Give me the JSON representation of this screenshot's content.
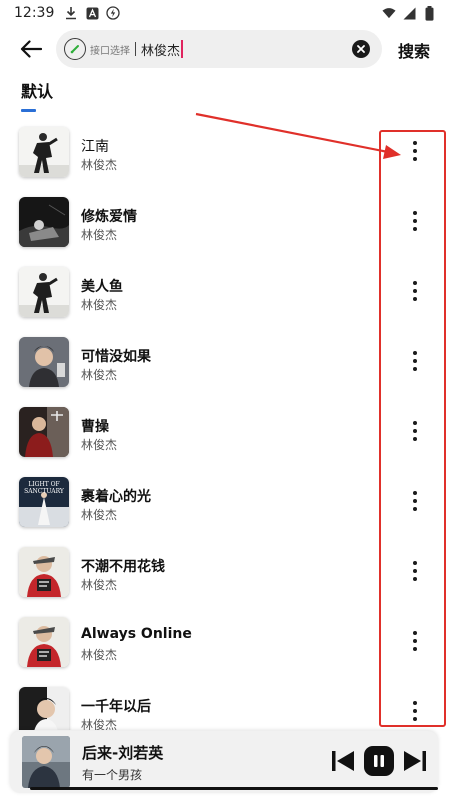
{
  "status_bar": {
    "time": "12:39",
    "left_icons": [
      "download-icon",
      "font-app-icon",
      "flash-icon"
    ],
    "right_icons": [
      "wifi-icon",
      "signal-icon",
      "battery-icon"
    ]
  },
  "search": {
    "api_label": "接口选择",
    "query": "林俊杰",
    "action_label": "搜索"
  },
  "tabs": [
    {
      "label": "默认",
      "active": true
    }
  ],
  "songs": [
    {
      "title": "江南",
      "artist": "林俊杰",
      "bold": false
    },
    {
      "title": "修炼爱情",
      "artist": "林俊杰",
      "bold": true
    },
    {
      "title": "美人鱼",
      "artist": "林俊杰",
      "bold": true
    },
    {
      "title": "可惜没如果",
      "artist": "林俊杰",
      "bold": true
    },
    {
      "title": "曹操",
      "artist": "林俊杰",
      "bold": true
    },
    {
      "title": "裹着心的光",
      "artist": "林俊杰",
      "bold": true
    },
    {
      "title": "不潮不用花钱",
      "artist": "林俊杰",
      "bold": true
    },
    {
      "title": "Always Online",
      "artist": "林俊杰",
      "bold": true
    },
    {
      "title": "一千年以后",
      "artist": "林俊杰",
      "bold": true
    }
  ],
  "cover_art": {
    "cover_texts": [
      "LIGHT OF SANCTUARY"
    ]
  },
  "now_playing": {
    "title": "后来-刘若英",
    "subtitle": "有一个男孩",
    "progress": 1.0
  },
  "colors": {
    "accent_tab": "#2a6fd6",
    "annotation": "#e0302a",
    "caret": "#e0245e"
  }
}
